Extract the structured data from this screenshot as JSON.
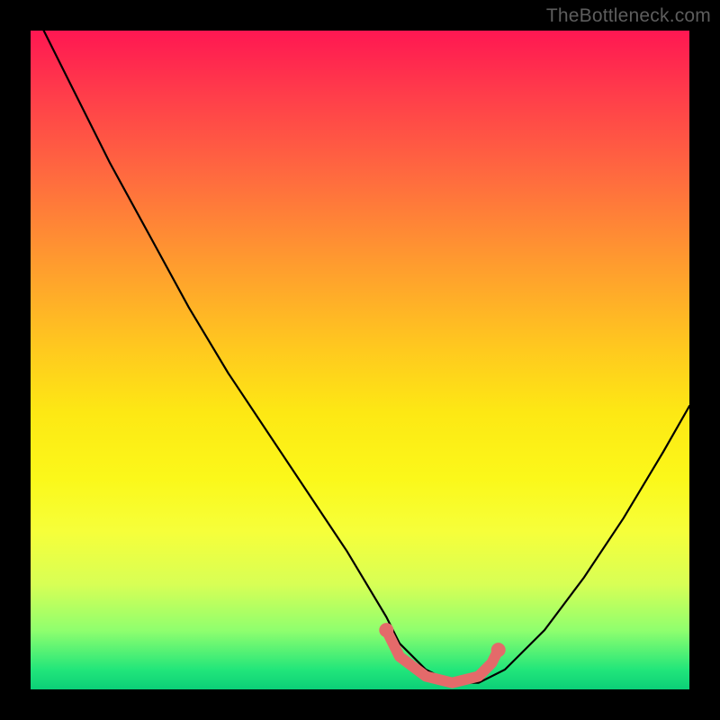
{
  "watermark": "TheBottleneck.com",
  "chart_data": {
    "type": "line",
    "title": "",
    "xlabel": "",
    "ylabel": "",
    "ylim": [
      0,
      100
    ],
    "xlim": [
      0,
      100
    ],
    "series": [
      {
        "name": "bottleneck-curve",
        "x": [
          0,
          6,
          12,
          18,
          24,
          30,
          36,
          42,
          48,
          54,
          56,
          60,
          64,
          68,
          72,
          78,
          84,
          90,
          96,
          100
        ],
        "y": [
          104,
          92,
          80,
          69,
          58,
          48,
          39,
          30,
          21,
          11,
          7,
          3,
          1,
          1,
          3,
          9,
          17,
          26,
          36,
          43
        ],
        "color": "#000000"
      },
      {
        "name": "highlight-segment",
        "x": [
          54,
          56,
          60,
          64,
          68,
          70,
          71
        ],
        "y": [
          9,
          5,
          2,
          1,
          2,
          4,
          6
        ],
        "color": "#e46a6a"
      }
    ],
    "highlight_points": [
      {
        "x": 54,
        "y": 9
      },
      {
        "x": 71,
        "y": 6
      }
    ]
  }
}
